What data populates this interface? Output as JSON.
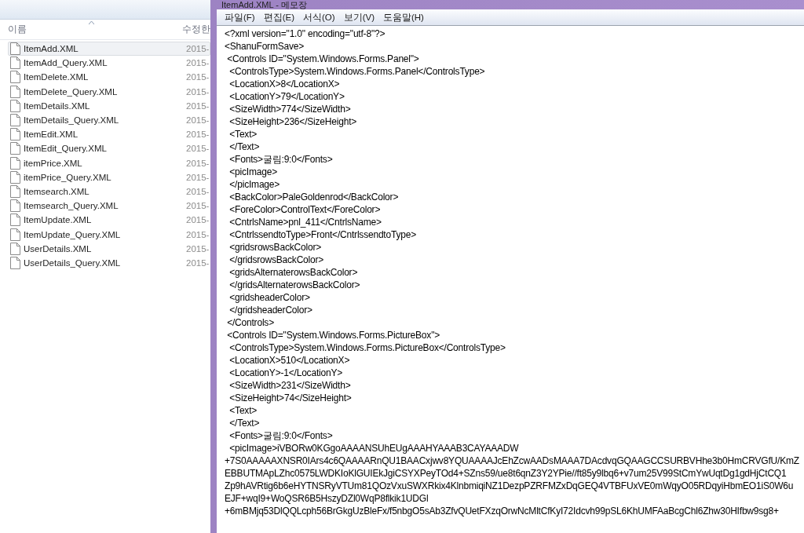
{
  "explorer": {
    "columns": [
      "이름",
      "수정한"
    ],
    "files": [
      {
        "name": "ItemAdd.XML",
        "date": "2015-",
        "selected": true
      },
      {
        "name": "ItemAdd_Query.XML",
        "date": "2015-",
        "selected": false
      },
      {
        "name": "ItemDelete.XML",
        "date": "2015-",
        "selected": false
      },
      {
        "name": "ItemDelete_Query.XML",
        "date": "2015-",
        "selected": false
      },
      {
        "name": "ItemDetails.XML",
        "date": "2015-",
        "selected": false
      },
      {
        "name": "ItemDetails_Query.XML",
        "date": "2015-",
        "selected": false
      },
      {
        "name": "ItemEdit.XML",
        "date": "2015-",
        "selected": false
      },
      {
        "name": "ItemEdit_Query.XML",
        "date": "2015-",
        "selected": false
      },
      {
        "name": "itemPrice.XML",
        "date": "2015-",
        "selected": false
      },
      {
        "name": "itemPrice_Query.XML",
        "date": "2015-",
        "selected": false
      },
      {
        "name": "Itemsearch.XML",
        "date": "2015-",
        "selected": false
      },
      {
        "name": "Itemsearch_Query.XML",
        "date": "2015-",
        "selected": false
      },
      {
        "name": "ItemUpdate.XML",
        "date": "2015-",
        "selected": false
      },
      {
        "name": "ItemUpdate_Query.XML",
        "date": "2015-",
        "selected": false
      },
      {
        "name": "UserDetails.XML",
        "date": "2015-",
        "selected": false
      },
      {
        "name": "UserDetails_Query.XML",
        "date": "2015-",
        "selected": false
      }
    ]
  },
  "notepad": {
    "title": "ItemAdd.XML - 메모장",
    "menu": [
      "파일(F)",
      "편집(E)",
      "서식(O)",
      "보기(V)",
      "도움말(H)"
    ],
    "lines": [
      "<?xml version=\"1.0\" encoding=\"utf-8\"?>",
      "<ShanuFormSave>",
      " <Controls ID=\"System.Windows.Forms.Panel\">",
      "  <ControlsType>System.Windows.Forms.Panel</ControlsType>",
      "  <LocationX>8</LocationX>",
      "  <LocationY>79</LocationY>",
      "  <SizeWidth>774</SizeWidth>",
      "  <SizeHeight>236</SizeHeight>",
      "  <Text>",
      "  </Text>",
      "  <Fonts>굴림:9:0</Fonts>",
      "  <picImage>",
      "  </picImage>",
      "  <BackColor>PaleGoldenrod</BackColor>",
      "  <ForeColor>ControlText</ForeColor>",
      "  <CntrlsName>pnl_411</CntrlsName>",
      "  <CntrlssendtoType>Front</CntrlssendtoType>",
      "  <gridsrowsBackColor>",
      "  </gridsrowsBackColor>",
      "  <gridsAlternaterowsBackColor>",
      "  </gridsAlternaterowsBackColor>",
      "  <gridsheaderColor>",
      "  </gridsheaderColor>",
      " </Controls>",
      " <Controls ID=\"System.Windows.Forms.PictureBox\">",
      "  <ControlsType>System.Windows.Forms.PictureBox</ControlsType>",
      "  <LocationX>510</LocationX>",
      "  <LocationY>-1</LocationY>",
      "  <SizeWidth>231</SizeWidth>",
      "  <SizeHeight>74</SizeHeight>",
      "  <Text>",
      "  </Text>",
      "  <Fonts>굴림:9:0</Fonts>",
      "  <picImage>iVBORw0KGgoAAAANSUhEUgAAAHYAAAB3CAYAAADW",
      "+7S0AAAAAXNSR0IArs4c6QAAAARnQU1BAACxjwv8YQUAAAAJcEhZcwAADsMAAA7DAcdvqGQAAGCCSURBVHhe3b0HmCRVGfU/KmZ",
      "EBBUTMApLZhc0575LWDKIoKlGUIEkJgiCSYXPeyTOd4+SZns59/ue8t6qnZ3Y2YPie//ft85y9lbq6+v7um25V99StCmYwUqtDg1gdHjCtCQ1",
      "Zp9hAVRtig6b6eHYTNSRyVTUm81QOzVxuSWXRkix4KlnbmiqiNZ1DezpPZRFMZxDqGEQ4VTBFUxVE0mWqyO05RDqyiHbmEO1iS0W6u",
      "EJF+wqI9+WoQSR6B5HszyDZl0WqP8flkik1UDGl",
      "+6mBMjq53DlQQLcph56BrGkgUzBleFx/f5nbgO5sAb3ZfvQUetFXzqOrwNcMltCfKyI72Idcvh99pSL6KhUMFAaBcgChl6Zhw30HIfbw9sg8+"
    ]
  }
}
